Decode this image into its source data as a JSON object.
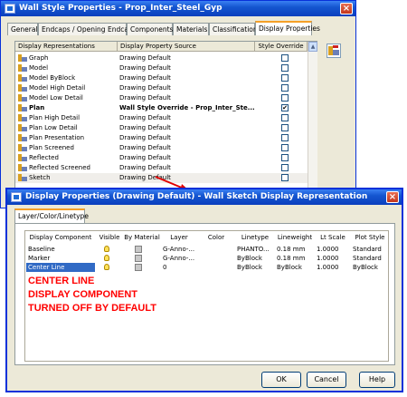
{
  "bg_window": {
    "title": "Wall Style Properties - Prop_Inter_Steel_Gyp",
    "tabs": [
      "General",
      "Endcaps / Opening Endcaps",
      "Components",
      "Materials",
      "Classifications",
      "Display Properties"
    ],
    "columns": [
      "Display Representations",
      "Display Property Source",
      "Style Override"
    ],
    "rows": [
      {
        "name": "Graph",
        "source": "Drawing Default",
        "override": ""
      },
      {
        "name": "Model",
        "source": "Drawing Default",
        "override": ""
      },
      {
        "name": "Model ByBlock",
        "source": "Drawing Default",
        "override": ""
      },
      {
        "name": "Model High Detail",
        "source": "Drawing Default",
        "override": ""
      },
      {
        "name": "Model Low Detail",
        "source": "Drawing Default",
        "override": ""
      },
      {
        "name": "Plan",
        "source": "Wall Style Override - Prop_Inter_Ste...",
        "override": "✔"
      },
      {
        "name": "Plan High Detail",
        "source": "Drawing Default",
        "override": ""
      },
      {
        "name": "Plan Low Detail",
        "source": "Drawing Default",
        "override": ""
      },
      {
        "name": "Plan Presentation",
        "source": "Drawing Default",
        "override": ""
      },
      {
        "name": "Plan Screened",
        "source": "Drawing Default",
        "override": ""
      },
      {
        "name": "Reflected",
        "source": "Drawing Default",
        "override": ""
      },
      {
        "name": "Reflected Screened",
        "source": "Drawing Default",
        "override": ""
      },
      {
        "name": "Sketch",
        "source": "Drawing Default",
        "override": ""
      }
    ]
  },
  "fg_dialog": {
    "title": "Display Properties (Drawing Default) - Wall Sketch Display Representation",
    "tab": "Layer/Color/Linetype",
    "columns": [
      "Display Component",
      "Visible",
      "By Material",
      "Layer",
      "Color",
      "Linetype",
      "Lineweight",
      "Lt Scale",
      "Plot Style"
    ],
    "rows": [
      {
        "component": "Baseline",
        "layer": "G-Anno-...",
        "color_label": "160",
        "color_hex": "#1f3fcf",
        "linetype": "PHANTO...",
        "lineweight": "0.18 mm",
        "ltscale": "1.0000",
        "plotstyle": "Standard"
      },
      {
        "component": "Marker",
        "layer": "G-Anno-...",
        "color_label": "yellow",
        "color_hex": "#ffe000",
        "linetype": "ByBlock",
        "lineweight": "0.18 mm",
        "ltscale": "1.0000",
        "plotstyle": "Standard"
      },
      {
        "component": "Center Line",
        "layer": "0",
        "color_label": "red",
        "color_hex": "#ff0000",
        "linetype": "ByBlock",
        "lineweight": "ByBlock",
        "ltscale": "1.0000",
        "plotstyle": "ByBlock"
      }
    ],
    "buttons": {
      "ok": "OK",
      "cancel": "Cancel",
      "help": "Help"
    }
  },
  "annotation": [
    "CENTER LINE",
    "DISPLAY COMPONENT",
    "TURNED OFF BY DEFAULT"
  ],
  "colors": {
    "accent_red": "#ff0000",
    "title_blue": "#0a3fbd"
  }
}
